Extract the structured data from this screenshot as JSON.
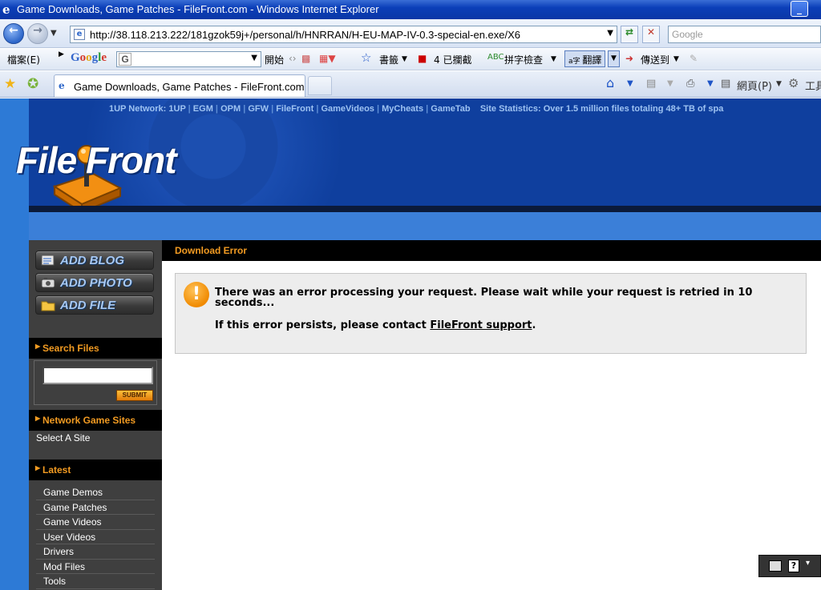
{
  "window": {
    "title": "Game Downloads, Game Patches - FileFront.com - Windows Internet Explorer",
    "minimize_label": "_"
  },
  "addressbar": {
    "url": "http://38.118.213.222/181gzok59j+/personal/h/HNRRAN/H-EU-MAP-IV-0.3-special-en.exe/X6",
    "search_placeholder": "Google",
    "back_icon": "back-arrow-icon",
    "forward_icon": "forward-arrow-icon"
  },
  "toolbar": {
    "file_menu": "檔案(E)",
    "google_logo": [
      "G",
      "o",
      "o",
      "g",
      "l",
      "e"
    ],
    "google_field": "G",
    "start_label": "開始",
    "bookmarks_label": "書籤",
    "blocked_label": "4 已攔截",
    "spellcheck_label": "拼字檢查",
    "translate_label": "翻譯",
    "sendto_label": "傳送到"
  },
  "tabs": {
    "active_label": "Game Downloads, Game Patches - FileFront.com",
    "page_menu": "網頁(P)",
    "tools_menu": "工具"
  },
  "header": {
    "network_text": "1UP Network:",
    "network_links": [
      "1UP",
      "EGM",
      "OPM",
      "GFW",
      "FileFront",
      "GameVideos",
      "MyCheats",
      "GameTab"
    ],
    "site_stats": "Site Statistics: Over 1.5 million files totaling 48+ TB of spa",
    "logo_text": "File Front"
  },
  "sidebar": {
    "add_blog": "ADD BLOG",
    "add_photo": "ADD PHOTO",
    "add_file": "ADD FILE",
    "search_header": "Search Files",
    "submit_label": "SUBMIT",
    "network_header": "Network Game Sites",
    "select_site": "Select A Site",
    "latest_header": "Latest",
    "latest_items": [
      "Game Demos",
      "Game Patches",
      "Game Videos",
      "User Videos",
      "Drivers",
      "Mod Files",
      "Tools"
    ]
  },
  "content": {
    "title": "Download Error",
    "error_line1": "There was an error processing your request. Please wait while your request is retried in 10 seconds...",
    "error_line2_prefix": "If this error persists, please contact ",
    "error_link": "FileFront support",
    "error_line2_suffix": ".",
    "warn_glyph": "!"
  },
  "ime": {
    "help_glyph": "?"
  },
  "colors": {
    "accent_orange": "#f29b22",
    "page_blue": "#2a72cc",
    "header_blue": "#0f3f9e"
  }
}
